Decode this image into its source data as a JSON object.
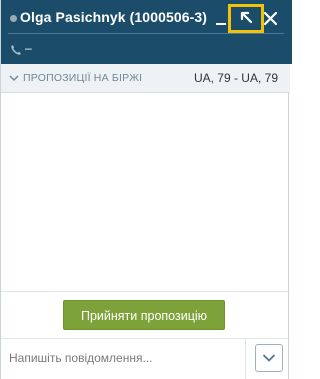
{
  "header": {
    "title": "Olga Pasichnyk (1000506-3)",
    "phone": "–",
    "colors": {
      "background": "#1b4d6b",
      "highlight": "#f2c10a"
    }
  },
  "subheader": {
    "label": "ПРОПОЗИЦІЇ НА БІРЖІ",
    "route": "UA, 79 - UA, 79"
  },
  "actions": {
    "accept_label": "Прийняти пропозицію",
    "accept_color": "#7da23a"
  },
  "composer": {
    "placeholder": "Напишіть повідомлення..."
  },
  "icons": [
    "status-dot",
    "phone-icon",
    "minimize-icon",
    "expand-icon",
    "close-icon",
    "chevron-down-icon",
    "chevron-down-icon"
  ]
}
